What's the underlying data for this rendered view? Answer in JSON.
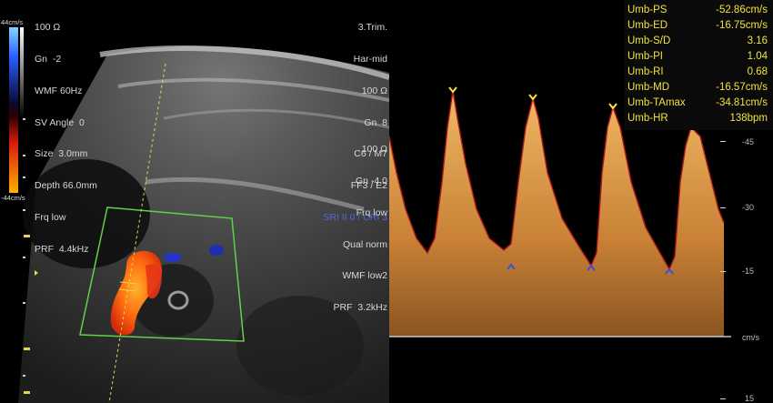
{
  "colorbar": {
    "top_label": "44cm/s",
    "bottom_label": "-44cm/s"
  },
  "left_params": [
    "100 Ω",
    "Gn  -2",
    "WMF 60Hz",
    "SV Angle  0",
    "Size  3.0mm",
    "Depth 66.0mm",
    "Frq low",
    "PRF  4.4kHz"
  ],
  "upper_right_params": [
    "3.Trim.",
    "Har-mid",
    "100 Ω",
    "Gn  8",
    "C6 / M7",
    "FF3 / E2",
    "SRI II 0 / CRI 3"
  ],
  "lower_right_params": [
    "100 Ω",
    "Gn -4.0",
    "Frq low",
    "Qual norm",
    "WMF low2",
    "PRF  3.2kHz"
  ],
  "measurements": [
    {
      "label": "Umb-PS",
      "value": "-52.86cm/s"
    },
    {
      "label": "Umb-ED",
      "value": "-16.75cm/s"
    },
    {
      "label": "Umb-S/D",
      "value": "3.16"
    },
    {
      "label": "Umb-PI",
      "value": "1.04"
    },
    {
      "label": "Umb-RI",
      "value": "0.68"
    },
    {
      "label": "Umb-MD",
      "value": "-16.57cm/s"
    },
    {
      "label": "Umb-TAmax",
      "value": "-34.81cm/s"
    },
    {
      "label": "Umb-HR",
      "value": "138bpm"
    }
  ],
  "velocity_scale": {
    "ticks": [
      "-45",
      "-30",
      "-15",
      "cm/s",
      "15"
    ],
    "baseline_unit": "cm/s"
  },
  "colors": {
    "measurement_text": "#f3e33c",
    "overlay_text": "#d8d8d8",
    "spectrum": "#e8a24a",
    "envelope": "#b01818",
    "caliper_peak": "#ffe23a",
    "caliper_trough": "#3a4fd8",
    "sample_box": "#5fd24a"
  }
}
